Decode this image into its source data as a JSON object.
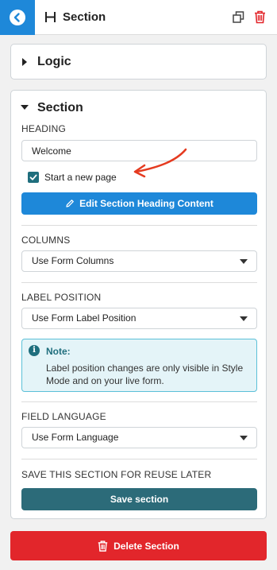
{
  "header": {
    "title": "Section",
    "back_icon": "chevron-left-icon",
    "section_icon": "section-icon",
    "duplicate_icon": "duplicate-icon",
    "delete_icon": "trash-icon",
    "accent_color": "#1e88d9",
    "delete_color": "#e2262b"
  },
  "logic": {
    "title": "Logic"
  },
  "section": {
    "title": "Section",
    "heading_label": "HEADING",
    "heading_value": "Welcome",
    "new_page_label": "Start a new page",
    "new_page_checked": true,
    "edit_button_label": "Edit Section Heading Content",
    "columns_label": "COLUMNS",
    "columns_value": "Use Form Columns",
    "label_position_label": "LABEL POSITION",
    "label_position_value": "Use Form Label Position",
    "note_title": "Note:",
    "note_text": "Label position changes are only visible in Style Mode and on your live form.",
    "field_language_label": "FIELD LANGUAGE",
    "field_language_value": "Use Form Language",
    "save_label": "SAVE THIS SECTION FOR REUSE LATER",
    "save_button_label": "Save section"
  },
  "footer": {
    "delete_button_label": "Delete Section"
  }
}
